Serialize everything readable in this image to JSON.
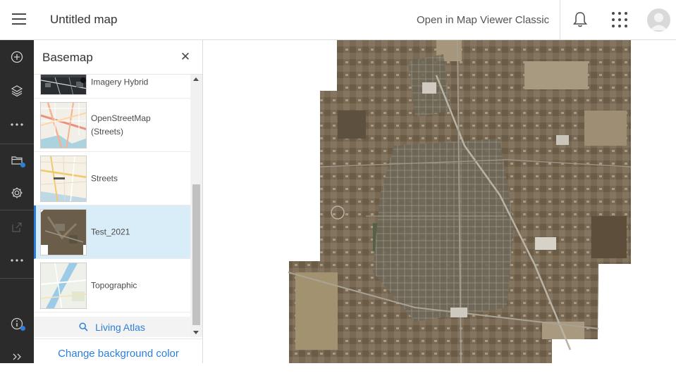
{
  "header": {
    "title": "Untitled map",
    "open_classic": "Open in Map Viewer Classic",
    "icons": [
      "menu-icon",
      "bell-icon",
      "app-launcher-icon",
      "user-avatar"
    ]
  },
  "toolbar": {
    "items": [
      "add-icon",
      "layers-icon",
      "more-icon",
      "basemap-icon",
      "settings-icon",
      "share-icon",
      "more-icon",
      "info-icon",
      "expand-icon"
    ]
  },
  "panel": {
    "title": "Basemap",
    "basemaps": [
      {
        "label": "Imagery Hybrid"
      },
      {
        "label": "OpenStreetMap (Streets)"
      },
      {
        "label": "Streets"
      },
      {
        "label": "Test_2021",
        "selected": true
      },
      {
        "label": "Topographic"
      }
    ],
    "living_atlas": "Living Atlas",
    "change_background": "Change background color"
  },
  "colors": {
    "accent": "#2b7fdb",
    "toolbar_bg": "#2b2b2b",
    "selected_bg": "#d9edf8"
  }
}
